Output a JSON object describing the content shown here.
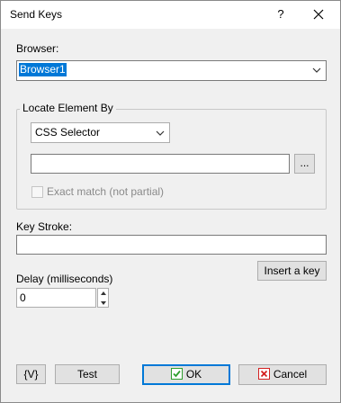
{
  "window": {
    "title": "Send Keys",
    "help_glyph": "?"
  },
  "browser": {
    "label": "Browser:",
    "value": "Browser1"
  },
  "locate": {
    "group_label": "Locate Element By",
    "method": "CSS Selector",
    "selector_value": "",
    "browse_label": "...",
    "exact_match_label": "Exact match (not partial)",
    "exact_match_checked": false
  },
  "keystroke": {
    "label": "Key Stroke:",
    "value": "",
    "insert_key_label": "Insert a key"
  },
  "delay": {
    "label": "Delay (milliseconds)",
    "value": "0"
  },
  "footer": {
    "variables_label": "{V}",
    "test_label": "Test",
    "ok_label": "OK",
    "cancel_label": "Cancel"
  },
  "colors": {
    "accent": "#0078d7",
    "ok_icon": "#2e9e2e",
    "cancel_icon": "#d42020"
  }
}
